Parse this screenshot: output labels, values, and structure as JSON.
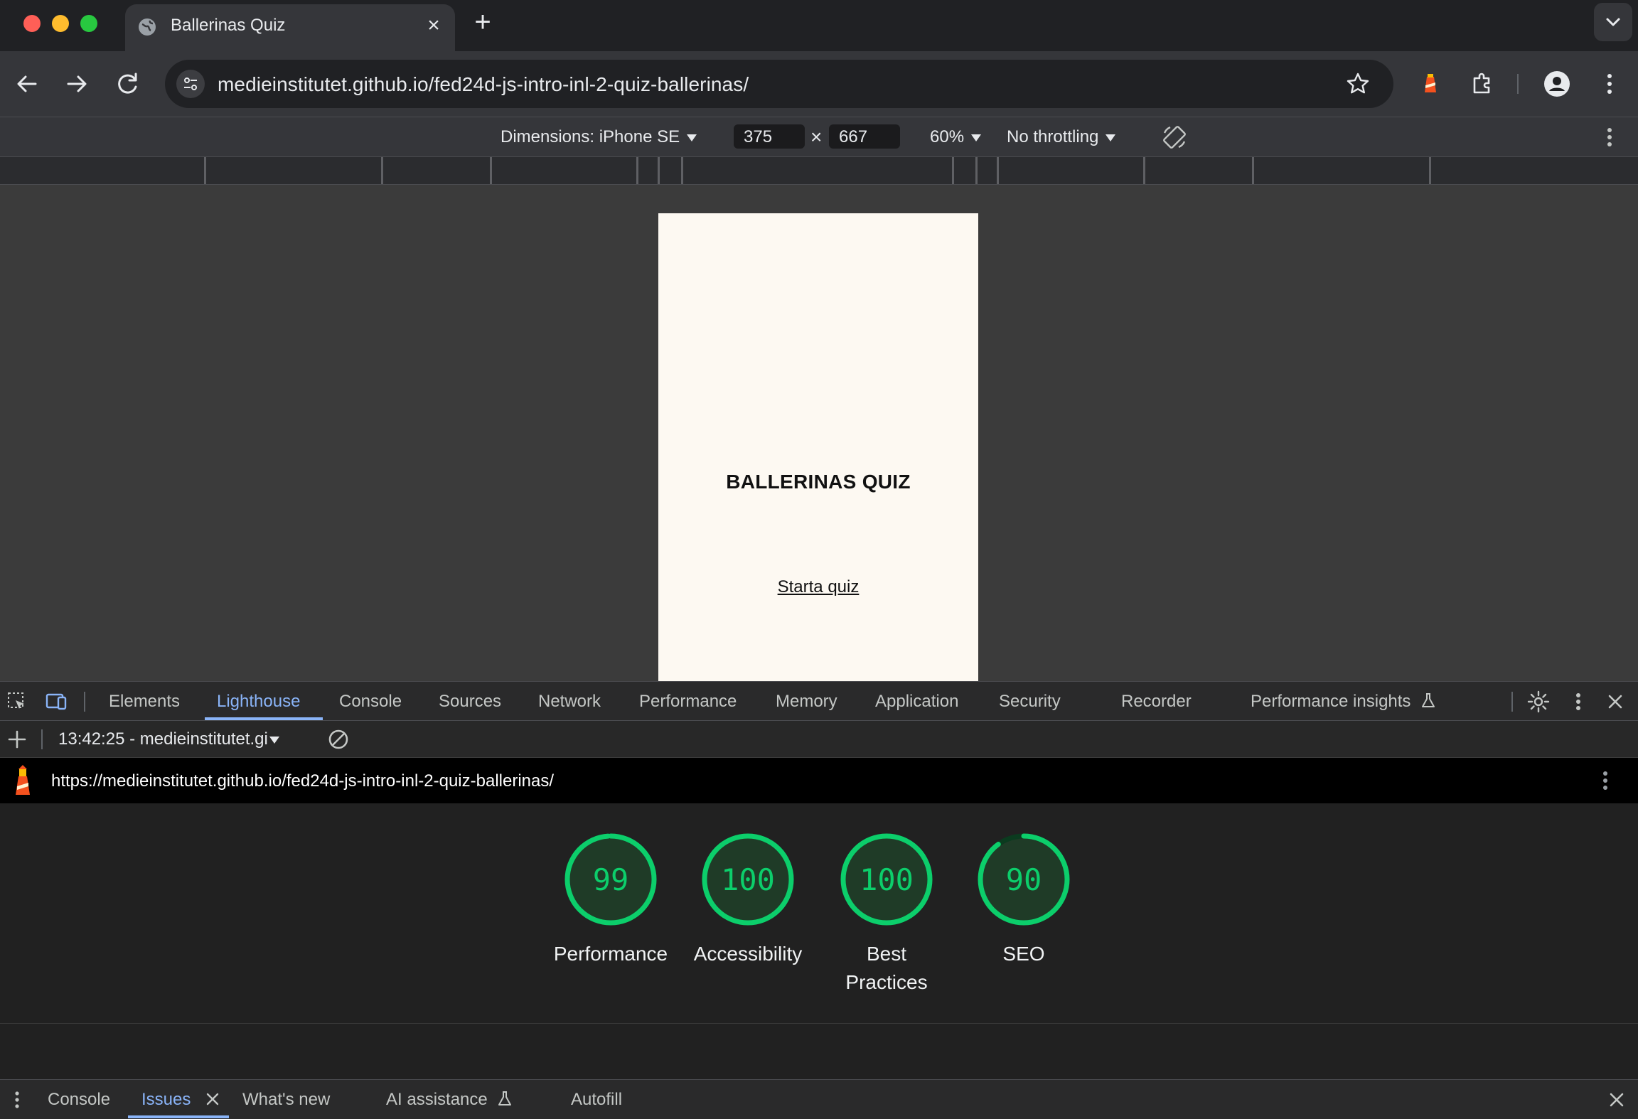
{
  "browser": {
    "tab_title": "Ballerinas Quiz",
    "url": "medieinstitutet.github.io/fed24d-js-intro-inl-2-quiz-ballerinas/"
  },
  "device_toolbar": {
    "dimensions_label": "Dimensions: iPhone SE",
    "width": "375",
    "times": "×",
    "height": "667",
    "zoom": "60%",
    "throttling": "No throttling"
  },
  "page": {
    "title": "BALLERINAS QUIZ",
    "start_link": "Starta quiz",
    "background_color": "#fdf9f2"
  },
  "devtools": {
    "tabs": [
      "Elements",
      "Lighthouse",
      "Console",
      "Sources",
      "Network",
      "Performance",
      "Memory",
      "Application",
      "Security",
      "Recorder",
      "Performance insights"
    ],
    "active_tab": "Lighthouse",
    "report_select": "13:42:25 - medieinstitutet.gi",
    "report_url": "https://medieinstitutet.github.io/fed24d-js-intro-inl-2-quiz-ballerinas/",
    "scores": [
      {
        "value": "99",
        "label": "Performance",
        "fraction": 0.99
      },
      {
        "value": "100",
        "label": "Accessibility",
        "fraction": 1.0
      },
      {
        "value": "100",
        "label": "Best Practices",
        "fraction": 1.0
      },
      {
        "value": "90",
        "label": "SEO",
        "fraction": 0.9
      }
    ],
    "score_color": "#0cce6b"
  },
  "drawer": {
    "tabs": [
      "Console",
      "Issues",
      "What's new",
      "AI assistance",
      "Autofill"
    ],
    "active_tab": "Issues"
  }
}
